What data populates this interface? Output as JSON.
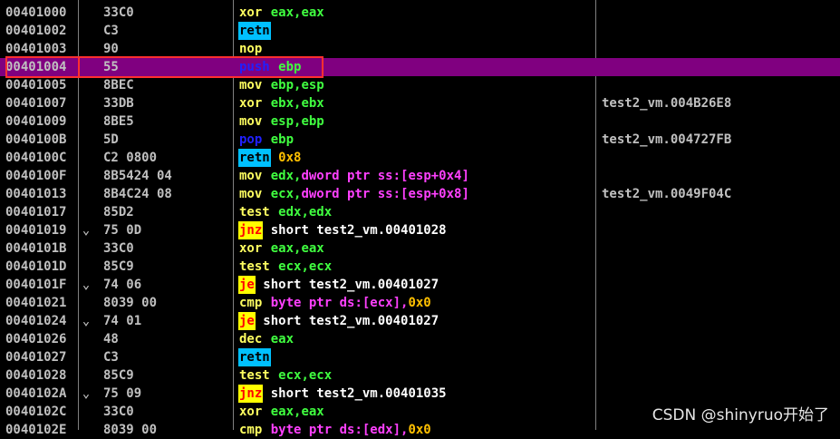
{
  "theme": {
    "mnemonic_colors": {
      "green": "#ffff60",
      "blue": "#2020ff",
      "cyan_box": "#00c0ff",
      "yellow_box": "#ffff00"
    },
    "operand_color": "#40ff40",
    "addr_color": "#c0c0c0",
    "mem_color": "#ff40ff",
    "imm_color": "#ffc000",
    "selected_row_bg": "#800080",
    "highlight_border": "#ff3030"
  },
  "rows": [
    {
      "addr": "00401000",
      "jmp": "",
      "hex": "33C0",
      "mn": "xor",
      "mnstyle": "green",
      "ops": "eax,eax",
      "cmt": ""
    },
    {
      "addr": "00401002",
      "jmp": "",
      "hex": "C3",
      "mn": "retn",
      "mnstyle": "box-cyan",
      "ops": "",
      "cmt": ""
    },
    {
      "addr": "00401003",
      "jmp": "",
      "hex": "90",
      "mn": "nop",
      "mnstyle": "green",
      "ops": "",
      "cmt": ""
    },
    {
      "addr": "00401004",
      "jmp": "",
      "hex": "55",
      "mn": "push",
      "mnstyle": "blue",
      "ops": "ebp",
      "cmt": "",
      "selected": true
    },
    {
      "addr": "00401005",
      "jmp": "",
      "hex": "8BEC",
      "mn": "mov",
      "mnstyle": "green",
      "ops": "ebp,esp",
      "cmt": ""
    },
    {
      "addr": "00401007",
      "jmp": "",
      "hex": "33DB",
      "mn": "xor",
      "mnstyle": "green",
      "ops": "ebx,ebx",
      "cmt": "test2_vm.004B26E8"
    },
    {
      "addr": "00401009",
      "jmp": "",
      "hex": "8BE5",
      "mn": "mov",
      "mnstyle": "green",
      "ops": "esp,ebp",
      "cmt": ""
    },
    {
      "addr": "0040100B",
      "jmp": "",
      "hex": "5D",
      "mn": "pop",
      "mnstyle": "blue",
      "ops": "ebp",
      "cmt": "test2_vm.004727FB"
    },
    {
      "addr": "0040100C",
      "jmp": "",
      "hex": "C2 0800",
      "mn": "retn",
      "mnstyle": "box-cyan",
      "ops": "0x8",
      "opstyle": "imm",
      "cmt": ""
    },
    {
      "addr": "0040100F",
      "jmp": "",
      "hex": "8B5424 04",
      "mn": "mov",
      "mnstyle": "green",
      "ops": "edx,dword ptr ss:[esp+0x4]",
      "opstyle": "mem",
      "cmt": ""
    },
    {
      "addr": "00401013",
      "jmp": "",
      "hex": "8B4C24 08",
      "mn": "mov",
      "mnstyle": "green",
      "ops": "ecx,dword ptr ss:[esp+0x8]",
      "opstyle": "mem",
      "cmt": "test2_vm.0049F04C"
    },
    {
      "addr": "00401017",
      "jmp": "",
      "hex": "85D2",
      "mn": "test",
      "mnstyle": "green",
      "ops": "edx,edx",
      "cmt": ""
    },
    {
      "addr": "00401019",
      "jmp": "⌄",
      "hex": "75 0D",
      "mn": "jnz",
      "mnstyle": "box-yellow",
      "ops": "short test2_vm.00401028",
      "opstyle": "jump",
      "cmt": ""
    },
    {
      "addr": "0040101B",
      "jmp": "",
      "hex": "33C0",
      "mn": "xor",
      "mnstyle": "green",
      "ops": "eax,eax",
      "cmt": ""
    },
    {
      "addr": "0040101D",
      "jmp": "",
      "hex": "85C9",
      "mn": "test",
      "mnstyle": "green",
      "ops": "ecx,ecx",
      "cmt": ""
    },
    {
      "addr": "0040101F",
      "jmp": "⌄",
      "hex": "74 06",
      "mn": "je",
      "mnstyle": "box-yellow",
      "ops": "short test2_vm.00401027",
      "opstyle": "jump",
      "cmt": ""
    },
    {
      "addr": "00401021",
      "jmp": "",
      "hex": "8039 00",
      "mn": "cmp",
      "mnstyle": "green",
      "ops": "byte ptr ds:[ecx],0x0",
      "opstyle": "cmp",
      "cmt": ""
    },
    {
      "addr": "00401024",
      "jmp": "⌄",
      "hex": "74 01",
      "mn": "je",
      "mnstyle": "box-yellow",
      "ops": "short test2_vm.00401027",
      "opstyle": "jump",
      "cmt": ""
    },
    {
      "addr": "00401026",
      "jmp": "",
      "hex": "48",
      "mn": "dec",
      "mnstyle": "green",
      "ops": "eax",
      "cmt": ""
    },
    {
      "addr": "00401027",
      "jmp": "",
      "hex": "C3",
      "mn": "retn",
      "mnstyle": "box-cyan",
      "ops": "",
      "cmt": ""
    },
    {
      "addr": "00401028",
      "jmp": "",
      "hex": "85C9",
      "mn": "test",
      "mnstyle": "green",
      "ops": "ecx,ecx",
      "cmt": ""
    },
    {
      "addr": "0040102A",
      "jmp": "⌄",
      "hex": "75 09",
      "mn": "jnz",
      "mnstyle": "box-yellow",
      "ops": "short test2_vm.00401035",
      "opstyle": "jump",
      "cmt": ""
    },
    {
      "addr": "0040102C",
      "jmp": "",
      "hex": "33C0",
      "mn": "xor",
      "mnstyle": "green",
      "ops": "eax,eax",
      "cmt": ""
    },
    {
      "addr": "0040102E",
      "jmp": "",
      "hex": "8039 00",
      "mn": "cmp",
      "mnstyle": "green",
      "ops": "byte ptr ds:[edx],0x0",
      "opstyle": "cmp",
      "cmt": ""
    }
  ],
  "watermark": "CSDN @shinyruo开始了"
}
